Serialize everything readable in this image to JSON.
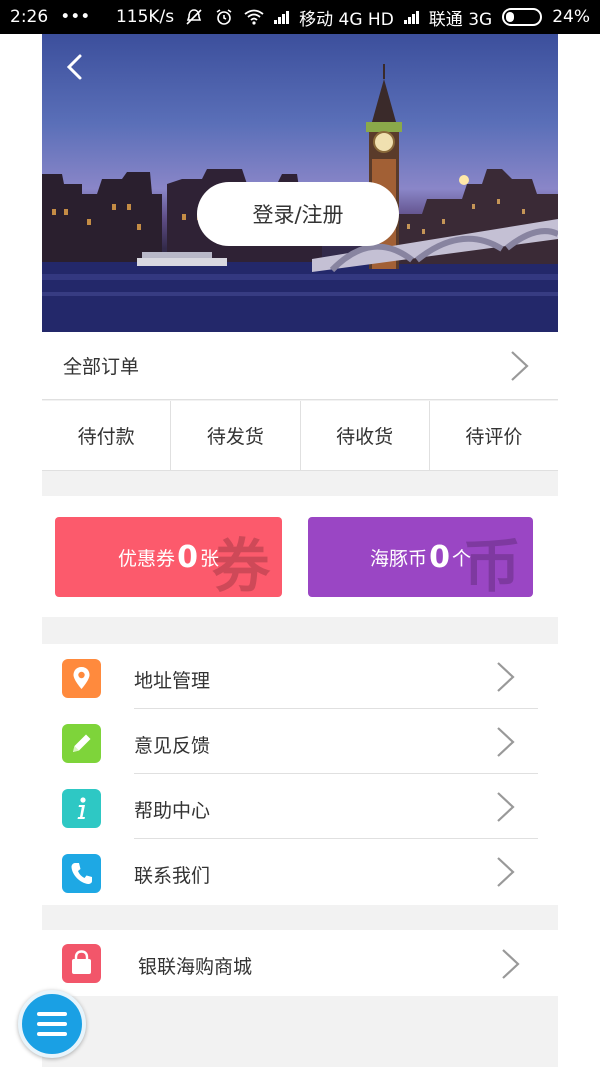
{
  "status_bar": {
    "time": "2:26",
    "dots": "•••",
    "speed": "115K/s",
    "carrier1": "移动 4G HD",
    "carrier2": "联通 3G",
    "battery": "24%",
    "battery_level": 0.24
  },
  "header": {
    "login_label": "登录/注册"
  },
  "orders": {
    "all_label": "全部订单",
    "tabs": [
      "待付款",
      "待发货",
      "待收货",
      "待评价"
    ]
  },
  "wallet": {
    "coupon": {
      "label": "优惠券",
      "count": "0",
      "unit": "张",
      "watermark": "券",
      "color": "#fc5a6c"
    },
    "coin": {
      "label": "海豚币",
      "count": "0",
      "unit": "个",
      "watermark": "币",
      "color": "#9a46c4"
    }
  },
  "menu": {
    "items": [
      {
        "label": "地址管理",
        "icon": "location-pin-icon",
        "color": "#ff8a3d"
      },
      {
        "label": "意见反馈",
        "icon": "pencil-icon",
        "color": "#7ed43a"
      },
      {
        "label": "帮助中心",
        "icon": "info-icon",
        "color": "#2ec8c4"
      },
      {
        "label": "联系我们",
        "icon": "phone-icon",
        "color": "#1ea8e4"
      }
    ]
  },
  "shop": {
    "label": "银联海购商城",
    "icon": "shopping-bag-icon",
    "color": "#f2566a"
  },
  "fab": {
    "icon": "menu-icon",
    "color": "#1aa0e4"
  }
}
